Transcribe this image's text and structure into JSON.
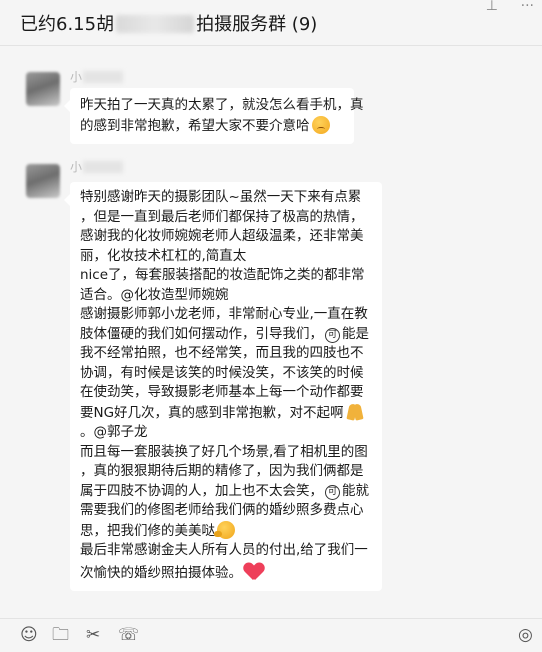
{
  "window": {
    "title_prefix": "已约6.15胡",
    "title_suffix": "拍摄服务群 (9)",
    "pin_icon": "pin-icon",
    "more_icon": "more-icon"
  },
  "messages": [
    {
      "sender": "小",
      "lines": [
        "昨天拍了一天真的太累了，就没怎么看手机，真",
        "的感到非常抱歉，希望大家不要介意哈"
      ]
    },
    {
      "sender": "小",
      "lines": [
        "特别感谢昨天的摄影团队~虽然一天下来有点累",
        "，但是一直到最后老师们都保持了极高的热情，",
        "感谢我的化妆师婉婉老师人超级温柔，还非常美",
        "丽，化妆技术杠杠的,简直太",
        "nice了，每套服装搭配的妆造配饰之类的都非常",
        "适合。@化妆造型师婉婉",
        "感谢摄影师郭小龙老师，非常耐心专业,一直在教",
        "肢体僵硬的我们如何摆动作，引导我们，",
        "能是",
        "我不经常拍照，也不经常笑，而且我的四肢也不",
        "协调，有时候是该笑的时候没笑，不该笑的时候",
        "在使劲笑，导致摄影老师基本上每一个动作都要",
        "要NG好几次，真的感到非常抱歉，对不起啊",
        "。@郭子龙",
        "而且每一套服装换了好几个场景,看了相机里的图",
        "，真的狠狠期待后期的精修了，因为我们俩都是",
        "属于四肢不协调的人，加上也不太会笑，",
        "能就",
        "需要我们的修图老师给我们俩的婚纱照多费点心",
        "思，把我们修的美美哒",
        "最后非常感谢金夫人所有人员的付出,给了我们一",
        "次愉快的婚纱照拍摄体验。"
      ],
      "circled_char": "可"
    }
  ],
  "toolbar": {
    "icons": [
      "emoji-icon",
      "folder-icon",
      "scissors-icon",
      "chat-bubble-icon"
    ],
    "right_icon": "voice-call-icon"
  }
}
